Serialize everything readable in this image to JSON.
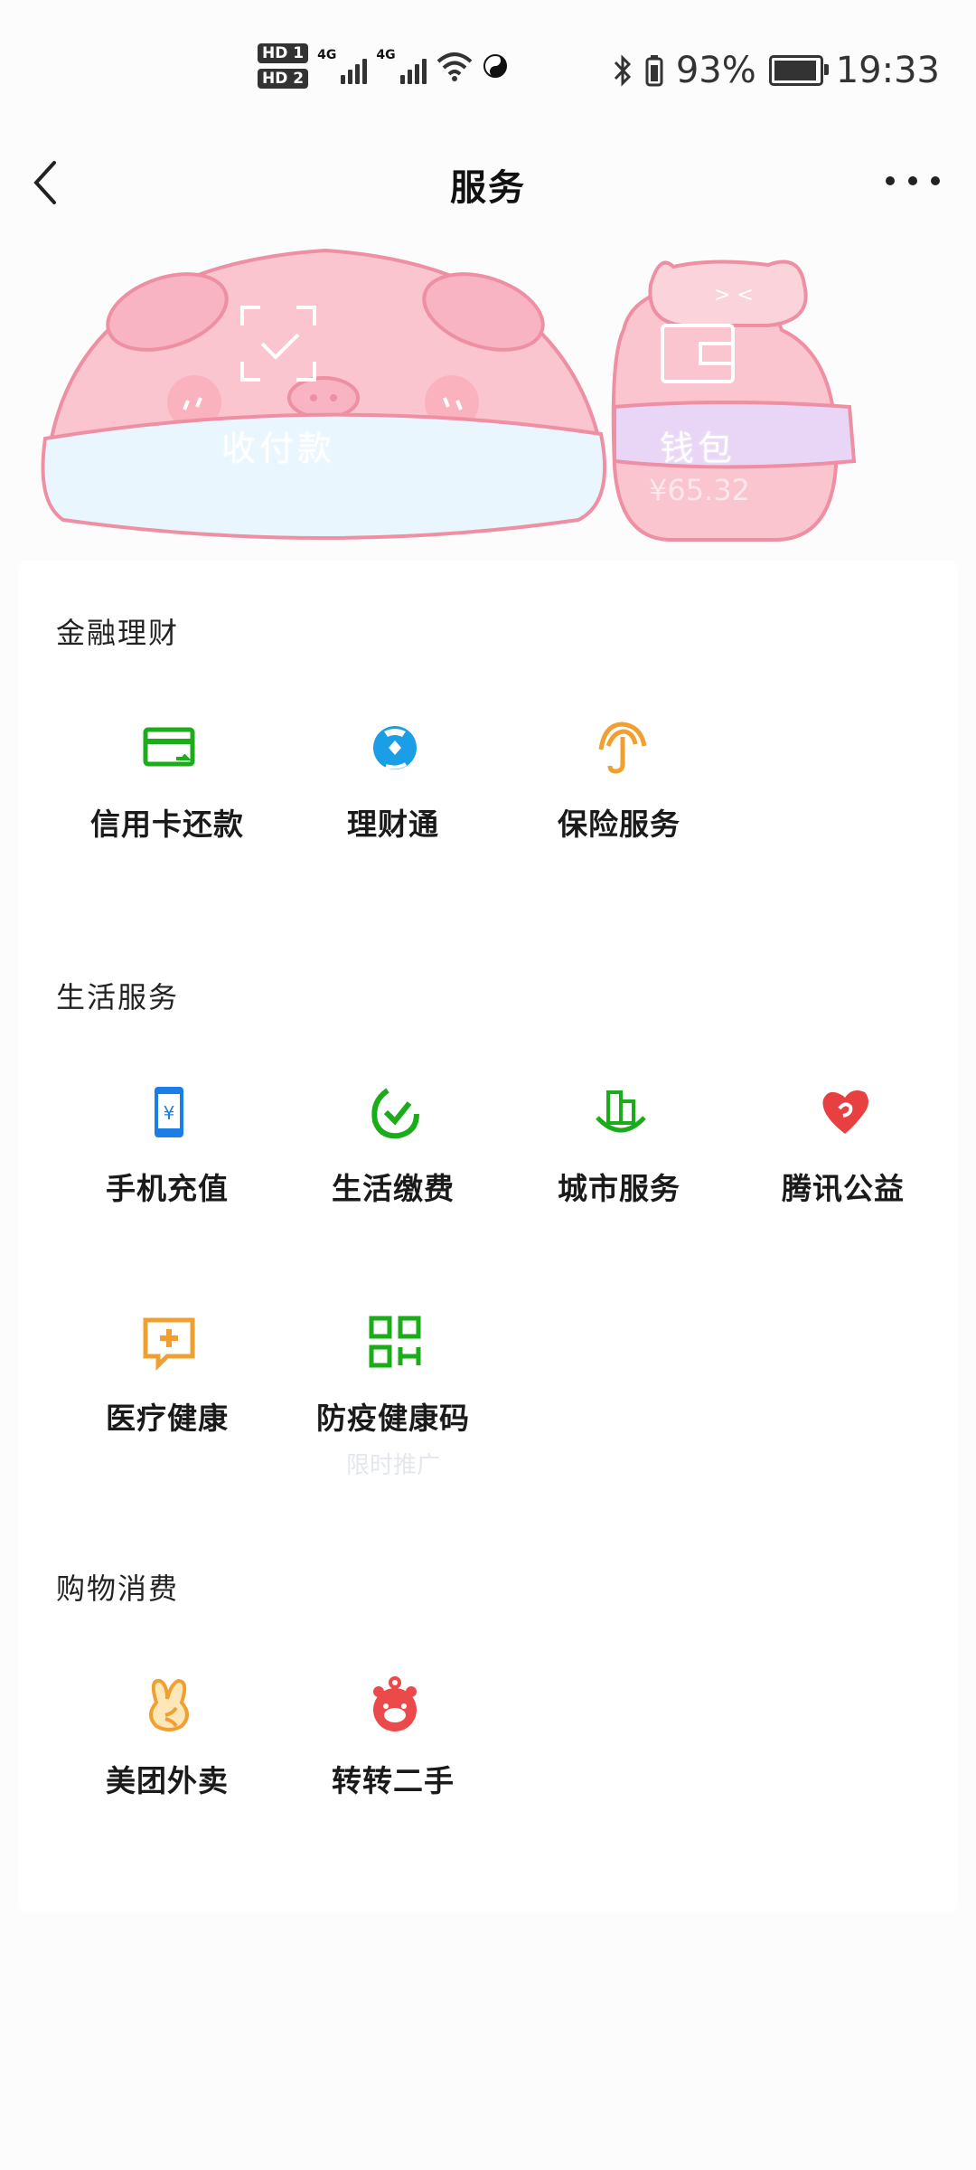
{
  "status_bar": {
    "hd1": "HD 1",
    "hd2": "HD 2",
    "net1": "4G",
    "net2": "4G",
    "battery": "93%",
    "time": "19:33"
  },
  "header": {
    "title": "服务"
  },
  "banner": {
    "pay_label": "收付款",
    "wallet_label": "钱包",
    "wallet_amount": "¥65.32"
  },
  "sections": [
    {
      "title": "金融理财",
      "items": [
        {
          "label": "信用卡还款",
          "icon": "credit-card-icon",
          "color": "#1aad19"
        },
        {
          "label": "理财通",
          "icon": "wealth-icon",
          "color": "#1a9ee6"
        },
        {
          "label": "保险服务",
          "icon": "umbrella-icon",
          "color": "#f0a030"
        }
      ]
    },
    {
      "title": "生活服务",
      "items": [
        {
          "label": "手机充值",
          "icon": "phone-icon",
          "color": "#1a7ee6"
        },
        {
          "label": "生活缴费",
          "icon": "check-leaf-icon",
          "color": "#1aad19"
        },
        {
          "label": "城市服务",
          "icon": "city-icon",
          "color": "#1aad19"
        },
        {
          "label": "腾讯公益",
          "icon": "heart-icon",
          "color": "#e84040"
        },
        {
          "label": "医疗健康",
          "icon": "medical-icon",
          "color": "#f0a030"
        },
        {
          "label": "防疫健康码",
          "icon": "qr-code-icon",
          "color": "#1aad19",
          "sub": "限时推广"
        }
      ]
    },
    {
      "title": "购物消费",
      "items": [
        {
          "label": "美团外卖",
          "icon": "rabbit-icon",
          "color": "#f0a030"
        },
        {
          "label": "转转二手",
          "icon": "zhuanzhuan-icon",
          "color": "#ec4a4a"
        }
      ]
    }
  ]
}
